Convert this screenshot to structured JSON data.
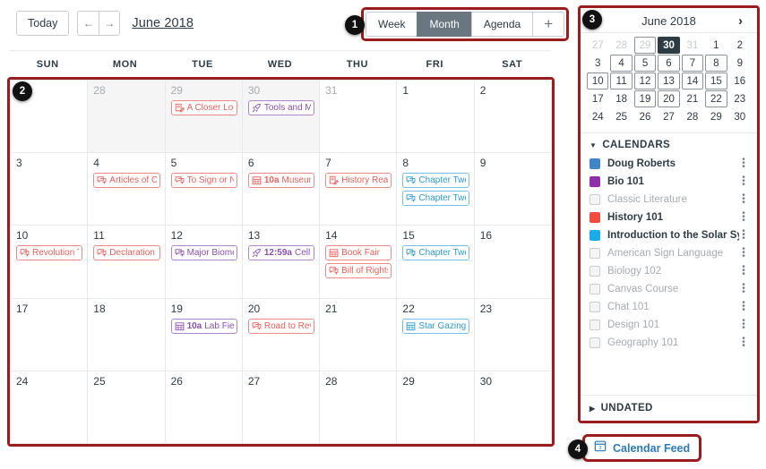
{
  "header": {
    "today_label": "Today",
    "prev_label": "←",
    "next_label": "→",
    "month_title": "June 2018",
    "views": [
      {
        "label": "Week",
        "active": false
      },
      {
        "label": "Month",
        "active": true
      },
      {
        "label": "Agenda",
        "active": false
      }
    ],
    "add_label": "+"
  },
  "badges": {
    "one": "1",
    "two": "2",
    "three": "3",
    "four": "4"
  },
  "grid": {
    "daynames": [
      "SUN",
      "MON",
      "TUE",
      "WED",
      "THU",
      "FRI",
      "SAT"
    ],
    "weeks": [
      [
        {
          "num": "",
          "other": true,
          "plain": true,
          "events": []
        },
        {
          "num": "28",
          "other": true,
          "events": []
        },
        {
          "num": "29",
          "other": true,
          "events": [
            {
              "icon": "assignment-icon",
              "color": "c-red",
              "time": "",
              "title": "A Closer Loo"
            }
          ]
        },
        {
          "num": "30",
          "other": true,
          "events": [
            {
              "icon": "rocket-icon",
              "color": "c-purple",
              "time": "",
              "title": "Tools and M"
            }
          ]
        },
        {
          "num": "31",
          "other": true,
          "plain": true,
          "events": []
        },
        {
          "num": "1",
          "other": false,
          "events": []
        },
        {
          "num": "2",
          "other": false,
          "events": []
        }
      ],
      [
        {
          "num": "3",
          "other": false,
          "events": []
        },
        {
          "num": "4",
          "other": false,
          "events": [
            {
              "icon": "discussion-icon",
              "color": "c-red",
              "time": "",
              "title": "Articles of C"
            }
          ]
        },
        {
          "num": "5",
          "other": false,
          "events": [
            {
              "icon": "discussion-icon",
              "color": "c-red",
              "time": "",
              "title": "To Sign or N"
            }
          ]
        },
        {
          "num": "6",
          "other": false,
          "events": [
            {
              "icon": "calendar-icon",
              "color": "c-red",
              "time": "10a",
              "title": "Museum"
            }
          ]
        },
        {
          "num": "7",
          "other": false,
          "events": [
            {
              "icon": "assignment-icon",
              "color": "c-red",
              "time": "",
              "title": "History Reac"
            }
          ]
        },
        {
          "num": "8",
          "other": false,
          "events": [
            {
              "icon": "discussion-icon",
              "color": "c-blue",
              "time": "",
              "title": "Chapter Twe"
            },
            {
              "icon": "discussion-icon",
              "color": "c-blue",
              "time": "",
              "title": "Chapter Twe"
            }
          ]
        },
        {
          "num": "9",
          "other": false,
          "events": []
        }
      ],
      [
        {
          "num": "10",
          "other": false,
          "events": [
            {
              "icon": "discussion-icon",
              "color": "c-red",
              "time": "",
              "title": "Revolution T"
            }
          ]
        },
        {
          "num": "11",
          "other": false,
          "events": [
            {
              "icon": "discussion-icon",
              "color": "c-red",
              "time": "",
              "title": "Declaration"
            }
          ]
        },
        {
          "num": "12",
          "other": false,
          "events": [
            {
              "icon": "discussion-icon",
              "color": "c-purple",
              "time": "",
              "title": "Major Biome"
            }
          ]
        },
        {
          "num": "13",
          "other": false,
          "events": [
            {
              "icon": "rocket-icon",
              "color": "c-purple",
              "time": "12:59a",
              "title": "Cell E"
            }
          ]
        },
        {
          "num": "14",
          "other": false,
          "events": [
            {
              "icon": "calendar-icon",
              "color": "c-red",
              "time": "",
              "title": "Book Fair"
            },
            {
              "icon": "discussion-icon",
              "color": "c-red",
              "time": "",
              "title": "Bill of Rights"
            }
          ]
        },
        {
          "num": "15",
          "other": false,
          "events": [
            {
              "icon": "discussion-icon",
              "color": "c-blue",
              "time": "",
              "title": "Chapter Twe"
            }
          ]
        },
        {
          "num": "16",
          "other": false,
          "events": []
        }
      ],
      [
        {
          "num": "17",
          "other": false,
          "events": []
        },
        {
          "num": "18",
          "other": false,
          "events": []
        },
        {
          "num": "19",
          "other": false,
          "events": [
            {
              "icon": "calendar-icon",
              "color": "c-purple",
              "time": "10a",
              "title": "Lab Field"
            }
          ]
        },
        {
          "num": "20",
          "other": false,
          "events": [
            {
              "icon": "discussion-icon",
              "color": "c-red",
              "time": "",
              "title": "Road to Rev"
            }
          ]
        },
        {
          "num": "21",
          "other": false,
          "events": []
        },
        {
          "num": "22",
          "other": false,
          "events": [
            {
              "icon": "calendar-icon",
              "color": "c-blue",
              "time": "",
              "title": "Star Gazing"
            }
          ]
        },
        {
          "num": "23",
          "other": false,
          "events": []
        }
      ],
      [
        {
          "num": "24",
          "other": false,
          "events": []
        },
        {
          "num": "25",
          "other": false,
          "events": []
        },
        {
          "num": "26",
          "other": false,
          "events": []
        },
        {
          "num": "27",
          "other": false,
          "events": []
        },
        {
          "num": "28",
          "other": false,
          "events": []
        },
        {
          "num": "29",
          "other": false,
          "events": []
        },
        {
          "num": "30",
          "other": false,
          "events": []
        }
      ]
    ]
  },
  "mini": {
    "prev": "‹",
    "next": "›",
    "title": "June 2018",
    "days": [
      {
        "n": "27",
        "dim": true,
        "ev": false,
        "today": false
      },
      {
        "n": "28",
        "dim": true,
        "ev": false,
        "today": false
      },
      {
        "n": "29",
        "dim": true,
        "ev": true,
        "today": false
      },
      {
        "n": "30",
        "dim": true,
        "ev": false,
        "today": true
      },
      {
        "n": "31",
        "dim": true,
        "ev": false,
        "today": false
      },
      {
        "n": "1",
        "dim": false,
        "ev": false,
        "today": false
      },
      {
        "n": "2",
        "dim": false,
        "ev": false,
        "today": false
      },
      {
        "n": "3",
        "dim": false,
        "ev": false,
        "today": false
      },
      {
        "n": "4",
        "dim": false,
        "ev": true,
        "today": false
      },
      {
        "n": "5",
        "dim": false,
        "ev": true,
        "today": false
      },
      {
        "n": "6",
        "dim": false,
        "ev": true,
        "today": false
      },
      {
        "n": "7",
        "dim": false,
        "ev": true,
        "today": false
      },
      {
        "n": "8",
        "dim": false,
        "ev": true,
        "today": false
      },
      {
        "n": "9",
        "dim": false,
        "ev": false,
        "today": false
      },
      {
        "n": "10",
        "dim": false,
        "ev": true,
        "today": false
      },
      {
        "n": "11",
        "dim": false,
        "ev": true,
        "today": false
      },
      {
        "n": "12",
        "dim": false,
        "ev": true,
        "today": false
      },
      {
        "n": "13",
        "dim": false,
        "ev": true,
        "today": false
      },
      {
        "n": "14",
        "dim": false,
        "ev": true,
        "today": false
      },
      {
        "n": "15",
        "dim": false,
        "ev": true,
        "today": false
      },
      {
        "n": "16",
        "dim": false,
        "ev": false,
        "today": false
      },
      {
        "n": "17",
        "dim": false,
        "ev": false,
        "today": false
      },
      {
        "n": "18",
        "dim": false,
        "ev": false,
        "today": false
      },
      {
        "n": "19",
        "dim": false,
        "ev": true,
        "today": false
      },
      {
        "n": "20",
        "dim": false,
        "ev": true,
        "today": false
      },
      {
        "n": "21",
        "dim": false,
        "ev": false,
        "today": false
      },
      {
        "n": "22",
        "dim": false,
        "ev": true,
        "today": false
      },
      {
        "n": "23",
        "dim": false,
        "ev": false,
        "today": false
      },
      {
        "n": "24",
        "dim": false,
        "ev": false,
        "today": false
      },
      {
        "n": "25",
        "dim": false,
        "ev": false,
        "today": false
      },
      {
        "n": "26",
        "dim": false,
        "ev": false,
        "today": false
      },
      {
        "n": "27",
        "dim": false,
        "ev": false,
        "today": false
      },
      {
        "n": "28",
        "dim": false,
        "ev": false,
        "today": false
      },
      {
        "n": "29",
        "dim": false,
        "ev": false,
        "today": false
      },
      {
        "n": "30",
        "dim": false,
        "ev": false,
        "today": false
      }
    ]
  },
  "sidebar": {
    "calendars_label": "CALENDARS",
    "undated_label": "UNDATED",
    "kebab_label": "⋮",
    "calendars": [
      {
        "name": "Doug Roberts",
        "color": "#4285C9",
        "enabled": true
      },
      {
        "name": "Bio 101",
        "color": "#8E2FA8",
        "enabled": true
      },
      {
        "name": "Classic Literature",
        "color": "",
        "enabled": false
      },
      {
        "name": "History 101",
        "color": "#F24B3F",
        "enabled": true
      },
      {
        "name": "Introduction to the Solar System",
        "color": "#19AEE8",
        "enabled": true
      },
      {
        "name": "American Sign Language",
        "color": "",
        "enabled": false
      },
      {
        "name": "Biology 102",
        "color": "",
        "enabled": false
      },
      {
        "name": "Canvas Course",
        "color": "",
        "enabled": false
      },
      {
        "name": "Chat 101",
        "color": "",
        "enabled": false
      },
      {
        "name": "Design 101",
        "color": "",
        "enabled": false
      },
      {
        "name": "Geography 101",
        "color": "",
        "enabled": false
      }
    ]
  },
  "feed": {
    "label": "Calendar Feed"
  },
  "colors": {
    "highlight": "#9B1C1C",
    "red_event": "#EE5E5B",
    "purple_event": "#8B4FB3",
    "blue_event": "#2B9BD6",
    "today_bg": "#2D3B45",
    "link": "#2B7ABC"
  }
}
